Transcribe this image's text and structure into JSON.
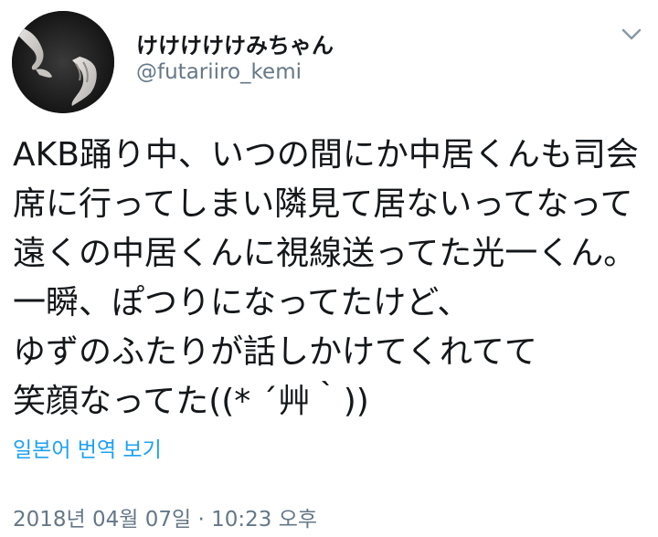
{
  "user": {
    "display_name": "けけけけけみちゃん",
    "handle": "@futariiro_kemi",
    "avatar_icon": "avatar-hands-photo"
  },
  "menu": {
    "icon": "chevron-down-icon"
  },
  "tweet": {
    "lines": [
      "AKB踊り中、いつの間にか中居くんも司会",
      "席に行ってしまい隣見て居ないってなって",
      "遠くの中居くんに視線送ってた光一くん。",
      "一瞬、ぽつりになってたけど、",
      "ゆずのふたりが話しかけてくれてて",
      "笑顔なってた((* ´艸｀))"
    ]
  },
  "translate_label": "일본어 번역 보기",
  "timestamp": "2018년 04월 07일 · 10:23 오후",
  "colors": {
    "text": "#14171a",
    "secondary": "#657786",
    "link": "#1da1f2"
  }
}
